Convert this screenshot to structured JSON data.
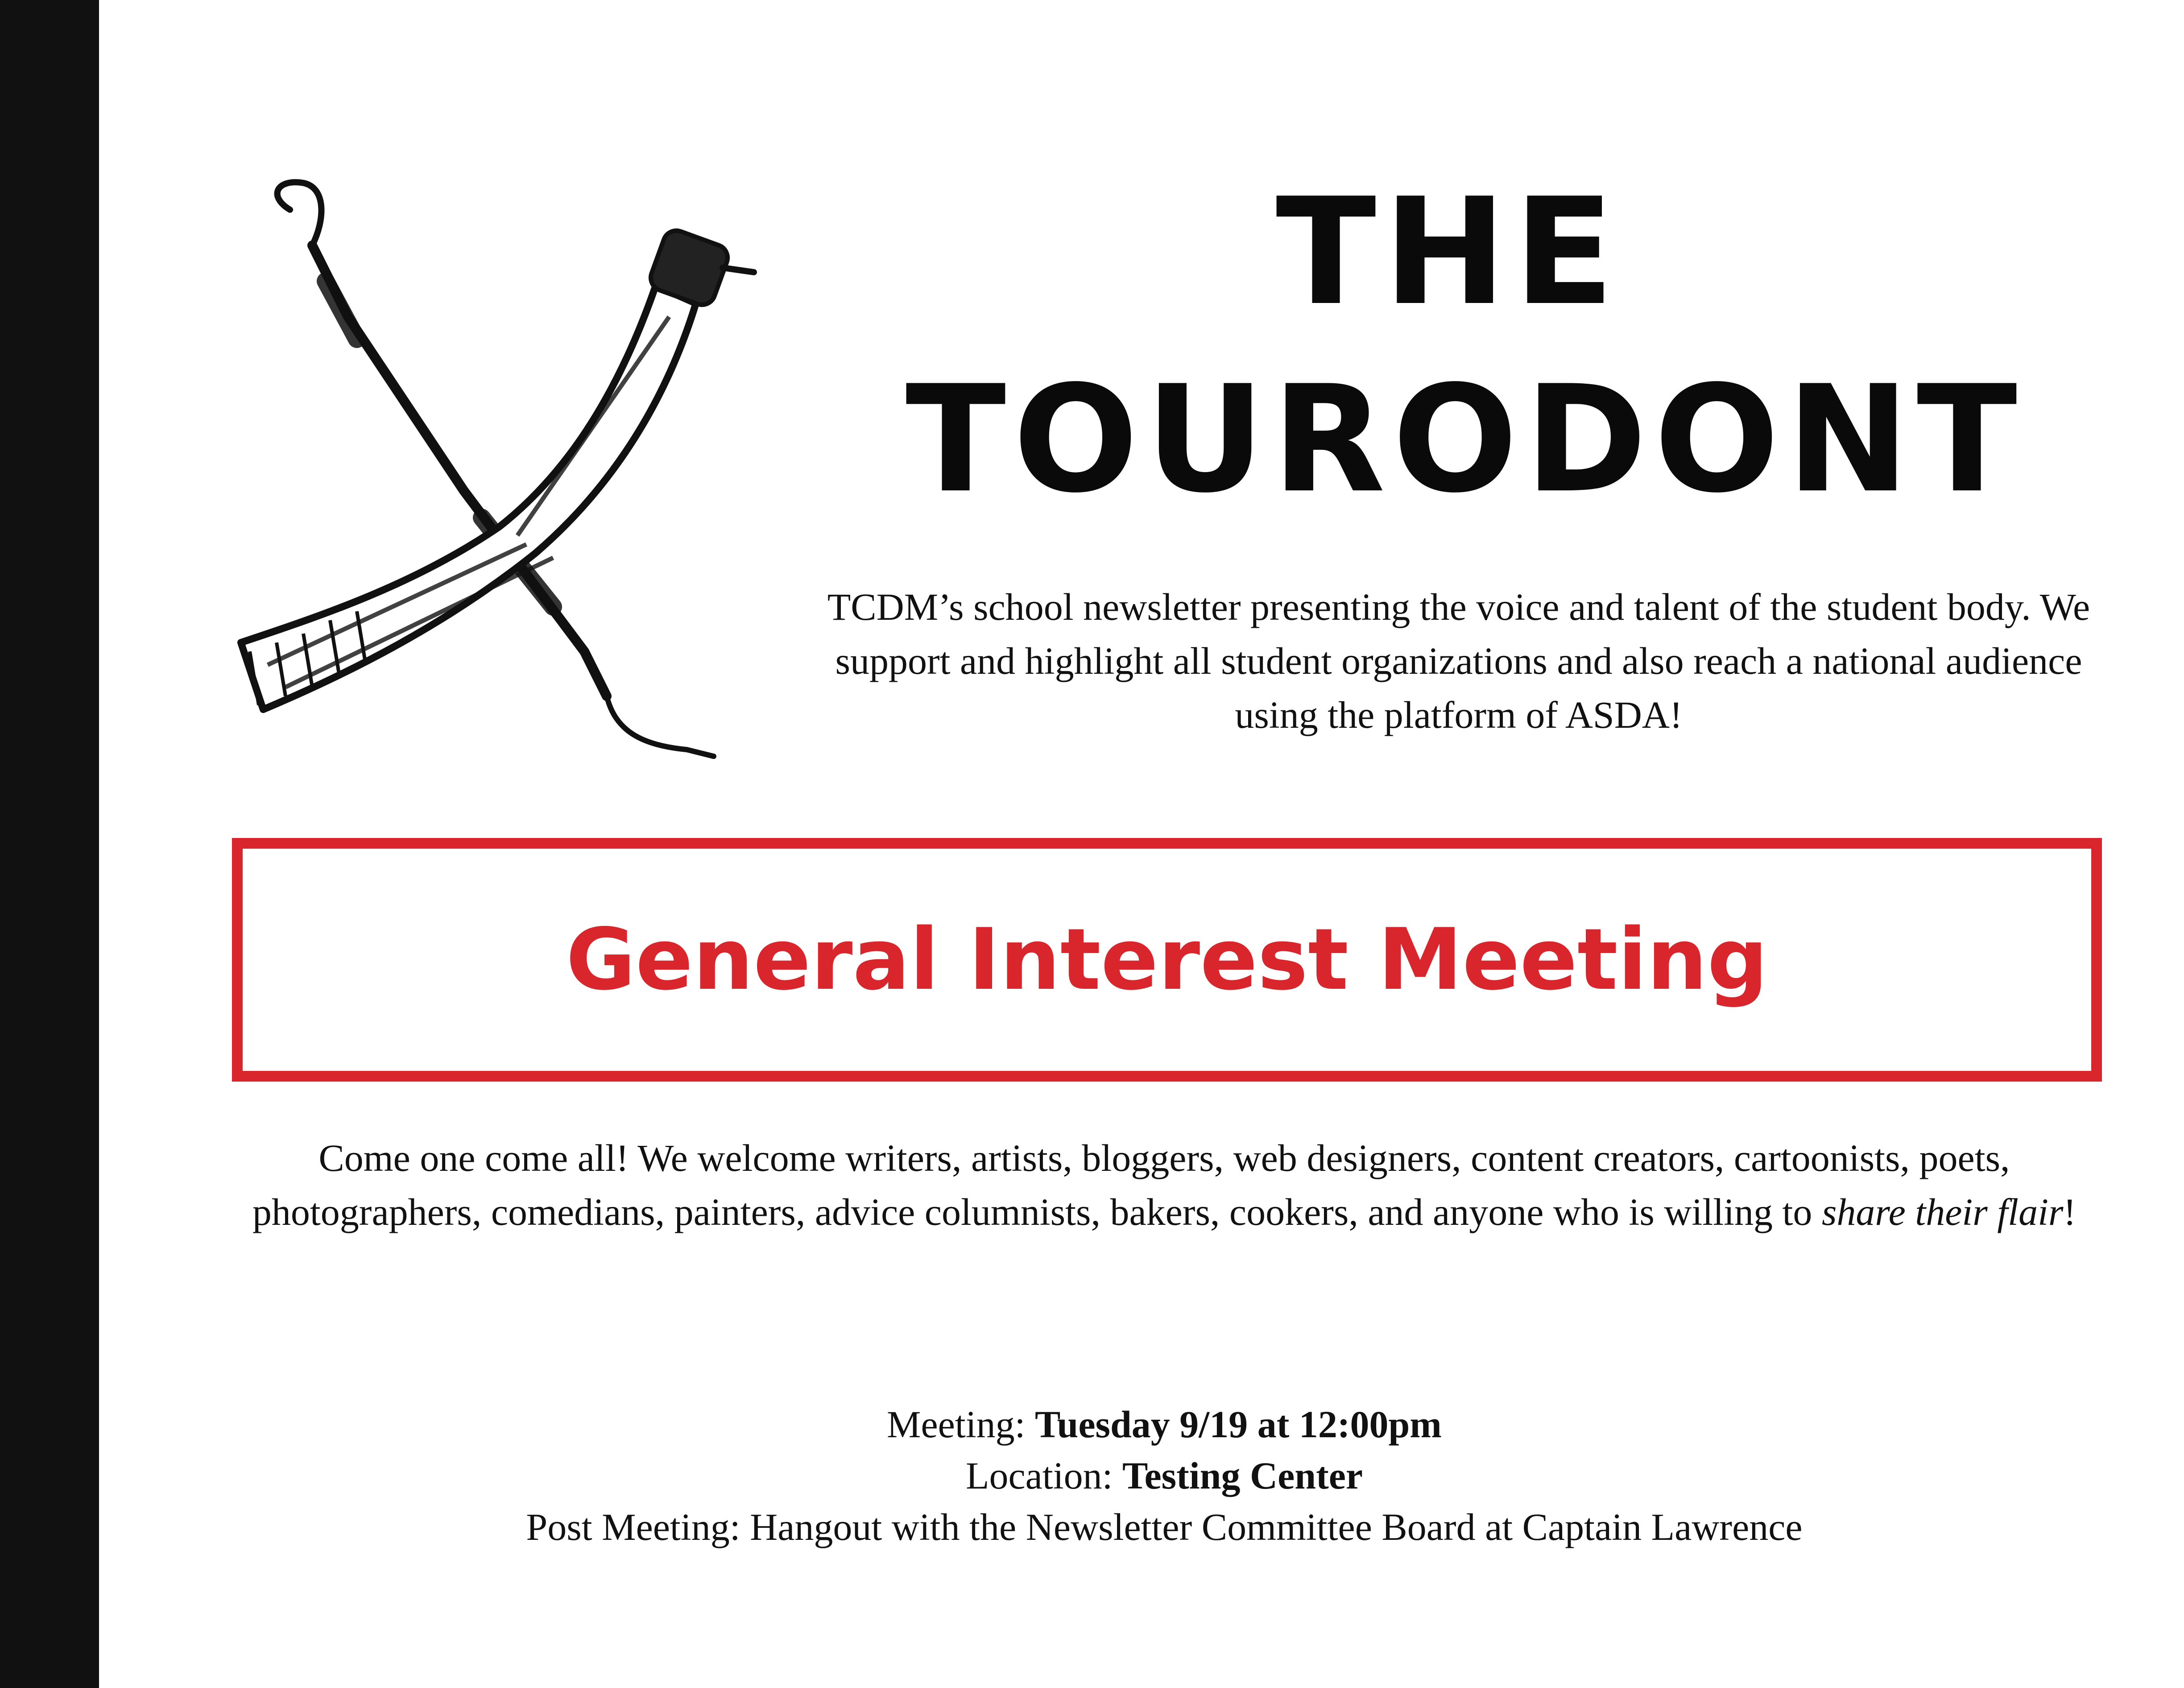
{
  "masthead": {
    "title_line1": "THE",
    "title_line2": "TOURODONT",
    "tagline": "TCDM’s school newsletter presenting the voice and talent of the student body. We support and highlight all student organizations and also reach a national audience using the platform of ASDA!"
  },
  "logo": {
    "icon": "crossed-dental-handpiece-and-explorer-icon"
  },
  "banner": {
    "title": "General Interest Meeting"
  },
  "intro": {
    "text_before": "Come one come all! We welcome writers, artists, bloggers, web designers, content creators, cartoonists, poets, photographers, comedians, painters, advice columnists, bakers, cookers, and anyone who is willing to ",
    "emphasis": "share their flair",
    "text_after": "!"
  },
  "details": {
    "meeting_label": "Meeting: ",
    "meeting_value": "Tuesday 9/19 at 12:00pm",
    "location_label": "Location: ",
    "location_value": "Testing Center",
    "post_meeting": "Post Meeting: Hangout with the Newsletter Committee Board at Captain Lawrence"
  },
  "colors": {
    "accent": "#d9252c",
    "text": "#111111",
    "spine": "#111111"
  }
}
